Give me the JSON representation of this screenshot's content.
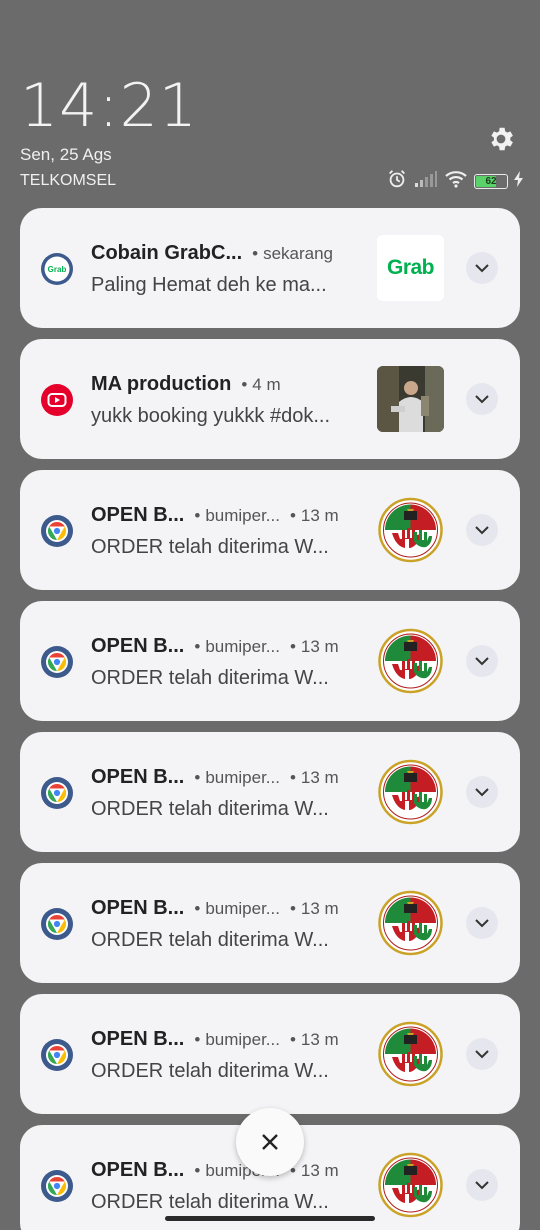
{
  "lockscreen": {
    "time": "14:21",
    "date": "Sen, 25 Ags",
    "carrier": "TELKOMSEL",
    "battery_level": "62",
    "settings_icon": "gear-icon"
  },
  "notifications": [
    {
      "app_icon": "grab-icon",
      "title": "Cobain GrabC...",
      "meta": [
        "sekarang"
      ],
      "body": "Paling Hemat deh ke ma...",
      "thumb": "grab-logo",
      "thumb_text": "Grab"
    },
    {
      "app_icon": "youtube-icon",
      "title": "MA production",
      "meta": [
        "4 m"
      ],
      "body": "yukk booking yukkk #dok...",
      "thumb": "video-thumbnail"
    },
    {
      "app_icon": "chrome-icon",
      "title": "OPEN B...",
      "meta": [
        "bumiper...",
        "13 m"
      ],
      "body": "ORDER telah diterima W...",
      "thumb": "emblem-logo"
    },
    {
      "app_icon": "chrome-icon",
      "title": "OPEN B...",
      "meta": [
        "bumiper...",
        "13 m"
      ],
      "body": "ORDER telah diterima W...",
      "thumb": "emblem-logo"
    },
    {
      "app_icon": "chrome-icon",
      "title": "OPEN B...",
      "meta": [
        "bumiper...",
        "13 m"
      ],
      "body": "ORDER telah diterima W...",
      "thumb": "emblem-logo"
    },
    {
      "app_icon": "chrome-icon",
      "title": "OPEN B...",
      "meta": [
        "bumiper...",
        "13 m"
      ],
      "body": "ORDER telah diterima W...",
      "thumb": "emblem-logo"
    },
    {
      "app_icon": "chrome-icon",
      "title": "OPEN B...",
      "meta": [
        "bumiper...",
        "13 m"
      ],
      "body": "ORDER telah diterima W...",
      "thumb": "emblem-logo"
    },
    {
      "app_icon": "chrome-icon",
      "title": "OPEN B...",
      "meta": [
        "bumiper...",
        "13 m"
      ],
      "body": "ORDER telah diterima W...",
      "thumb": "emblem-logo"
    }
  ],
  "colors": {
    "background": "#6b6b6b",
    "card": "#f4f4f6",
    "grab_green": "#00b14f",
    "youtube_red": "#e4002b",
    "chrome_ring": "#3d5a8c"
  }
}
